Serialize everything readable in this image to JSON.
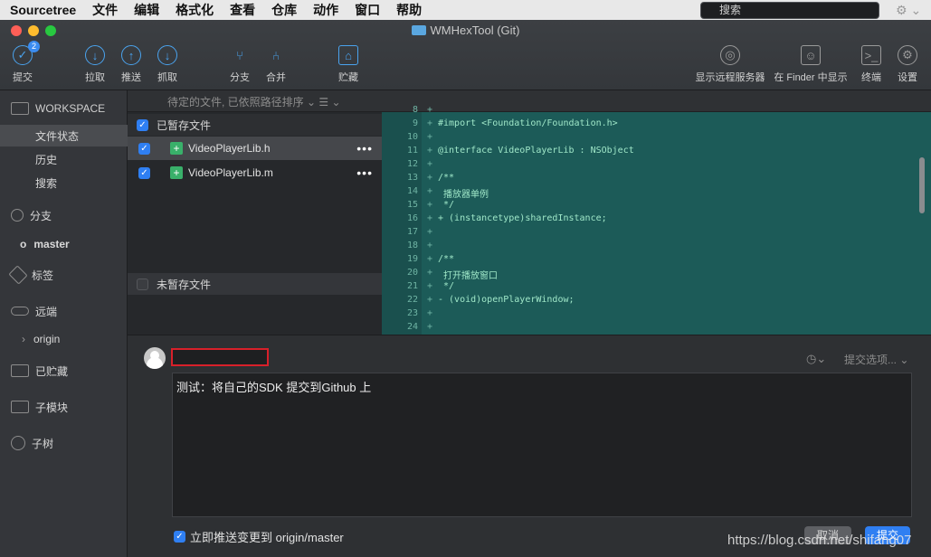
{
  "menubar": {
    "app": "Sourcetree",
    "items": [
      "文件",
      "编辑",
      "格式化",
      "查看",
      "仓库",
      "动作",
      "窗口",
      "帮助"
    ]
  },
  "window": {
    "title": "WMHexTool (Git)"
  },
  "toolbar": {
    "commit": {
      "label": "提交",
      "badge": "2"
    },
    "pull": "拉取",
    "push": "推送",
    "fetch": "抓取",
    "branch": "分支",
    "merge": "合并",
    "stash": "贮藏",
    "remote": "显示远程服务器",
    "finder": "在 Finder 中显示",
    "terminal": "终端",
    "settings": "设置"
  },
  "subbar": {
    "sort": "待定的文件, 已依照路径排序 ⌄  ☰ ⌄",
    "search_placeholder": "搜索"
  },
  "sidebar": {
    "workspace": "WORKSPACE",
    "file_status": "文件状态",
    "history": "历史",
    "search": "搜索",
    "branches": "分支",
    "master": "master",
    "tags": "标签",
    "remotes": "远端",
    "origin": "origin",
    "stashes": "已贮藏",
    "submodules": "子模块",
    "subtrees": "子树"
  },
  "staged": {
    "header": "已暂存文件",
    "files": [
      "VideoPlayerLib.h",
      "VideoPlayerLib.m"
    ]
  },
  "unstaged": {
    "header": "未暂存文件"
  },
  "diff": {
    "lines": [
      {
        "n": "8",
        "pm": "+",
        "code": ""
      },
      {
        "n": "9",
        "pm": "+",
        "code": "#import <Foundation/Foundation.h>"
      },
      {
        "n": "10",
        "pm": "+",
        "code": ""
      },
      {
        "n": "11",
        "pm": "+",
        "code": "@interface VideoPlayerLib : NSObject"
      },
      {
        "n": "12",
        "pm": "+",
        "code": ""
      },
      {
        "n": "13",
        "pm": "+",
        "code": "/**"
      },
      {
        "n": "14",
        "pm": "+",
        "code": " 播放器单例"
      },
      {
        "n": "15",
        "pm": "+",
        "code": " */"
      },
      {
        "n": "16",
        "pm": "+",
        "code": "+ (instancetype)sharedInstance;"
      },
      {
        "n": "17",
        "pm": "+",
        "code": ""
      },
      {
        "n": "18",
        "pm": "+",
        "code": ""
      },
      {
        "n": "19",
        "pm": "+",
        "code": "/**"
      },
      {
        "n": "20",
        "pm": "+",
        "code": " 打开播放窗口"
      },
      {
        "n": "21",
        "pm": "+",
        "code": " */"
      },
      {
        "n": "22",
        "pm": "+",
        "code": "- (void)openPlayerWindow;"
      },
      {
        "n": "23",
        "pm": "+",
        "code": ""
      },
      {
        "n": "24",
        "pm": "+",
        "code": ""
      }
    ]
  },
  "commit": {
    "options": "提交选项... ⌄",
    "message": "测试：将自己的SDK 提交到Github 上",
    "push_label": "立即推送变更到 origin/master",
    "cancel": "取消",
    "submit": "提交"
  },
  "watermark": "https://blog.csdn.net/shifang07"
}
